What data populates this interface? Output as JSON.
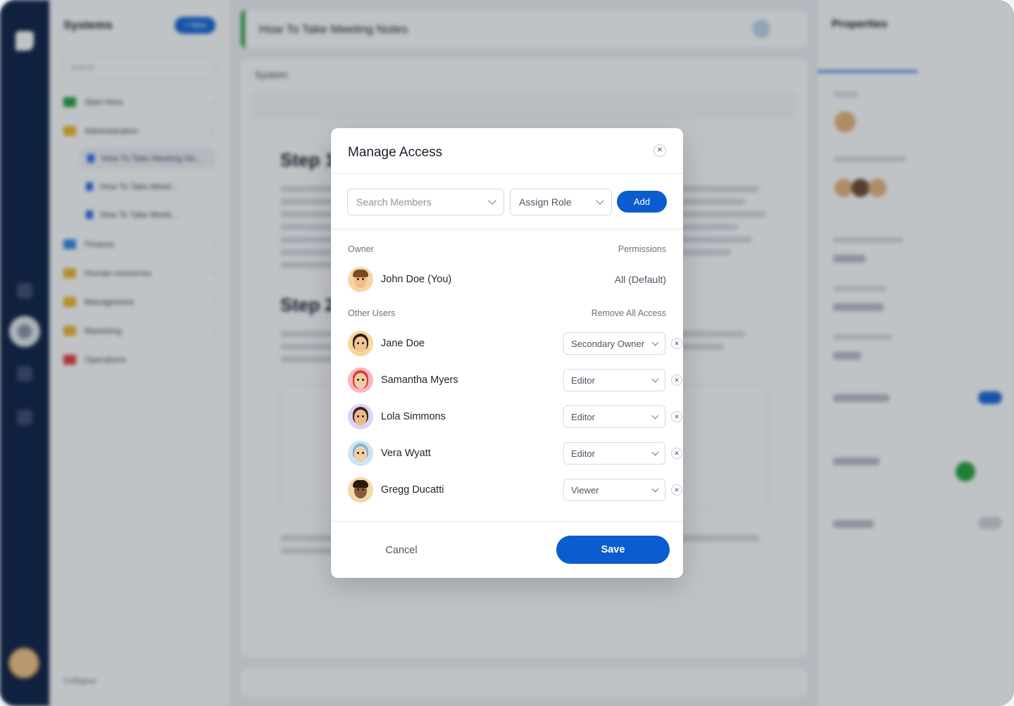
{
  "background": {
    "sidebar_title": "Systems",
    "new_button": "+ New",
    "search_placeholder": "search",
    "tree": [
      {
        "label": "Start Here",
        "color": "#22a03a"
      },
      {
        "label": "Administration",
        "color": "#f0b429"
      },
      {
        "label": "How To Take Meeting No...",
        "doc": true
      },
      {
        "label": "How To Take Meeti...",
        "doc": true
      },
      {
        "label": "How To Take Meeti...",
        "doc": true
      },
      {
        "label": "Finance",
        "color": "#2b8ae6"
      },
      {
        "label": "Human resources",
        "color": "#f0b429"
      },
      {
        "label": "Management",
        "color": "#f0b429"
      },
      {
        "label": "Marketing",
        "color": "#f0b429"
      },
      {
        "label": "Operations",
        "color": "#e53935"
      }
    ],
    "collapse_label": "Collapse",
    "doc_title": "How To Take Meeting Notes",
    "doc_section": "System",
    "step1": "Step 1",
    "step2": "Step 2",
    "properties_title": "Properties"
  },
  "modal": {
    "title": "Manage Access",
    "search_placeholder": "Search Members",
    "assign_role": "Assign Role",
    "add_button": "Add",
    "owner_label": "Owner",
    "permissions_label": "Permissions",
    "owner": {
      "name": "John Doe (You)",
      "permission": "All (Default)"
    },
    "other_users_label": "Other Users",
    "remove_all_label": "Remove All Access",
    "users": [
      {
        "name": "Jane Doe",
        "role": "Secondary Owner"
      },
      {
        "name": "Samantha Myers",
        "role": "Editor"
      },
      {
        "name": "Lola Simmons",
        "role": "Editor"
      },
      {
        "name": "Vera Wyatt",
        "role": "Editor"
      },
      {
        "name": "Gregg Ducatti",
        "role": "Viewer"
      }
    ],
    "cancel_button": "Cancel",
    "save_button": "Save"
  },
  "colors": {
    "accent": "#0b5ccf",
    "rail": "#0b1f44"
  }
}
